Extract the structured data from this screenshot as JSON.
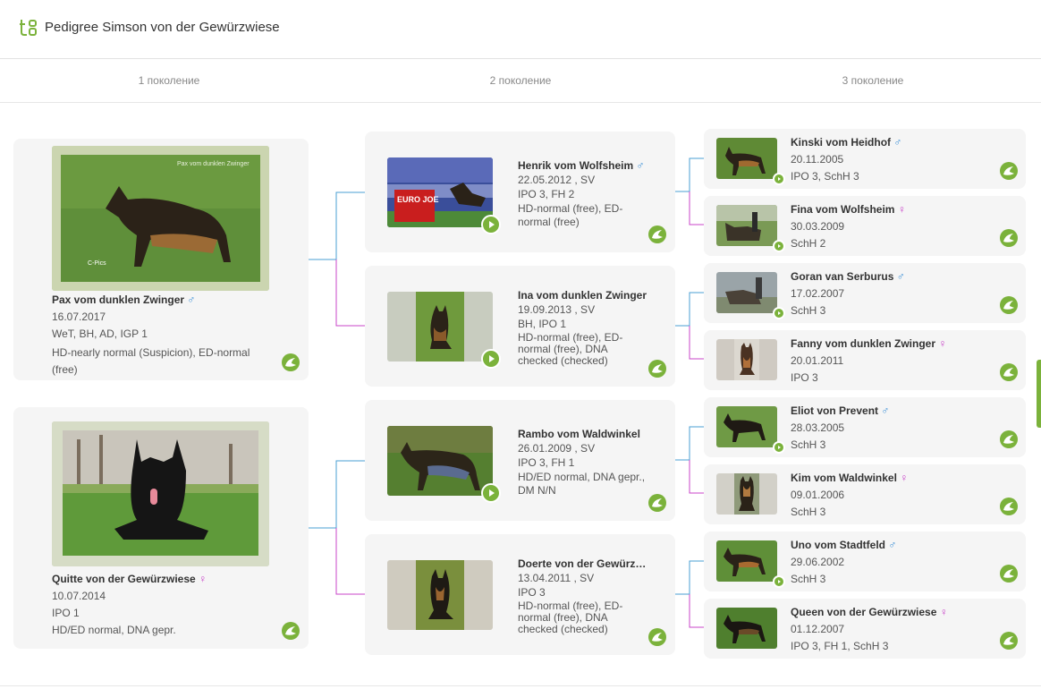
{
  "header": {
    "title": "Pedigree Simson von der Gewürzwiese"
  },
  "generations": [
    "1 поколение",
    "2 поколение",
    "3 поколение"
  ],
  "colors": {
    "accent": "#7bb23b",
    "male": "#3b8fd6",
    "female": "#c844c8",
    "connector_male": "#4a9fd3",
    "connector_female": "#c844c8"
  },
  "gen1": [
    {
      "name": "Pax vom dunklen Zwinger",
      "sex_icon": "♂",
      "date": "16.07.2017",
      "titles": "WeT, BH, AD, IGP 1",
      "health": "HD-nearly normal (Suspicion), ED-normal (free)",
      "watermark": "Pax vom dunklen Zwinger",
      "image_caption": "C-Pics"
    },
    {
      "name": "Quitte von der Gewürzwiese",
      "sex_icon": "♀",
      "date": "10.07.2014",
      "titles": "IPO 1",
      "health": "HD/ED normal, DNA gepr."
    }
  ],
  "gen2": [
    {
      "name": "Henrik vom Wolfsheim",
      "sex_icon": "♂",
      "date": "22.05.2012 , SV",
      "titles": "IPO 3, FH 2",
      "health": "HD-normal (free), ED-normal (free)",
      "banner": "EURO JOE"
    },
    {
      "name": "Ina vom dunklen Zwinger",
      "sex_icon": "",
      "date": "19.09.2013 , SV",
      "titles": "BH, IPO 1",
      "health": "HD-normal (free), ED-normal (free), DNA checked (checked)"
    },
    {
      "name": "Rambo vom Waldwinkel",
      "sex_icon": "",
      "date": "26.01.2009 , SV",
      "titles": "IPO 3, FH 1",
      "health": "HD/ED normal, DNA gepr., DM N/N"
    },
    {
      "name": "Doerte von der Gewürzwiese",
      "sex_icon": "",
      "date": "13.04.2011 , SV",
      "titles": "IPO 3",
      "health": "HD-normal (free), ED-normal (free), DNA checked (checked)"
    }
  ],
  "gen3": [
    {
      "name": "Kinski vom Heidhof",
      "sex_icon": "♂",
      "date": "20.11.2005",
      "titles": "IPO 3, SchH 3"
    },
    {
      "name": "Fina vom Wolfsheim",
      "sex_icon": "♀",
      "date": "30.03.2009",
      "titles": "SchH 2"
    },
    {
      "name": "Goran van Serburus",
      "sex_icon": "♂",
      "date": "17.02.2007",
      "titles": "SchH 3"
    },
    {
      "name": "Fanny vom dunklen Zwinger",
      "sex_icon": "♀",
      "date": "20.01.2011",
      "titles": "IPO 3"
    },
    {
      "name": "Eliot von Prevent",
      "sex_icon": "♂",
      "date": "28.03.2005",
      "titles": "SchH 3"
    },
    {
      "name": "Kim vom Waldwinkel",
      "sex_icon": "♀",
      "date": "09.01.2006",
      "titles": "SchH 3"
    },
    {
      "name": "Uno vom Stadtfeld",
      "sex_icon": "♂",
      "date": "29.06.2002",
      "titles": "SchH 3"
    },
    {
      "name": "Queen von der Gewürzwiese",
      "sex_icon": "♀",
      "date": "01.12.2007",
      "titles": "IPO 3, FH 1, SchH 3"
    }
  ]
}
